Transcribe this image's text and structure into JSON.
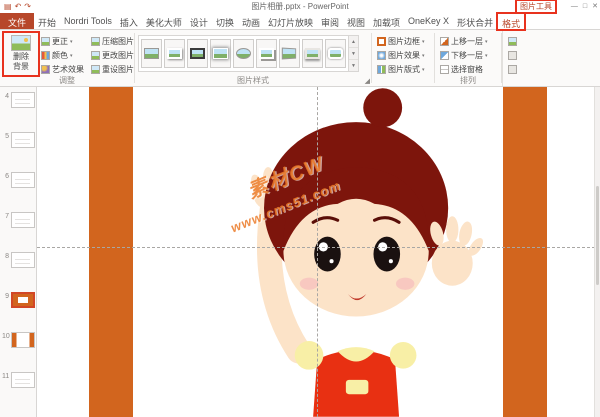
{
  "colors": {
    "accent": "#B7472A",
    "slide_orange": "#D2651E",
    "annotation_red": "#E8321E",
    "selected_thumb_border": "#D24726"
  },
  "icons": {
    "save": "▤",
    "undo": "↶",
    "redo": "↷",
    "caret": "▾",
    "min": "—",
    "max": "□",
    "close": "✕",
    "scroll_up": "▲",
    "scroll_down": "▼",
    "gallery_more": "▼",
    "launcher": "◢"
  },
  "title_bar": {
    "title": "图片相册.pptx - PowerPoint",
    "context_label": "图片工具"
  },
  "tabs": [
    {
      "label": "文件"
    },
    {
      "label": "开始"
    },
    {
      "label": "Nordri Tools"
    },
    {
      "label": "插入"
    },
    {
      "label": "美化大师"
    },
    {
      "label": "设计"
    },
    {
      "label": "切换"
    },
    {
      "label": "动画"
    },
    {
      "label": "幻灯片放映"
    },
    {
      "label": "审阅"
    },
    {
      "label": "视图"
    },
    {
      "label": "加载项"
    },
    {
      "label": "OneKey X"
    },
    {
      "label": "形状合并"
    },
    {
      "label": "格式"
    }
  ],
  "ribbon": {
    "adjust": {
      "remove_bg_line1": "删除",
      "remove_bg_line2": "背景",
      "corrections": "更正",
      "color": "颜色",
      "artistic": "艺术效果",
      "compress": "压缩图片",
      "change": "更改图片",
      "reset": "重设图片",
      "group_label": "调整"
    },
    "styles": {
      "group_label": "图片样式"
    },
    "picture_format": {
      "border": "图片边框",
      "effects": "图片效果",
      "layout": "图片版式"
    },
    "arrange": {
      "forward": "上移一层",
      "backward": "下移一层",
      "pane": "选择窗格",
      "group_label": "排列"
    }
  },
  "sidebar": {
    "slides": [
      {
        "num": "4"
      },
      {
        "num": "5"
      },
      {
        "num": "6"
      },
      {
        "num": "7"
      },
      {
        "num": "8"
      },
      {
        "num": "9"
      },
      {
        "num": "10"
      },
      {
        "num": "11"
      }
    ]
  },
  "canvas": {
    "watermark_line1": "素材CW",
    "watermark_line2": "www.cms51.com"
  }
}
